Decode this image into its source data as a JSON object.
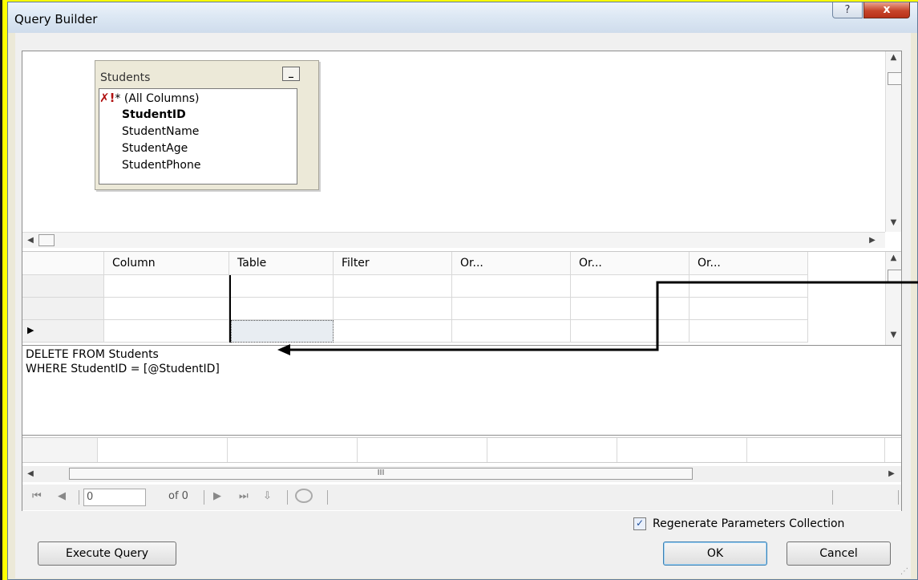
{
  "window": {
    "title": "Query Builder",
    "help_glyph": "?",
    "close_glyph": "x"
  },
  "diagram": {
    "table": {
      "name": "Students",
      "minimize_glyph": "_",
      "columns": [
        {
          "label": "* (All Columns)",
          "bold": false,
          "marker": "✗!"
        },
        {
          "label": "StudentID",
          "bold": true
        },
        {
          "label": "StudentName",
          "bold": false
        },
        {
          "label": "StudentAge",
          "bold": false
        },
        {
          "label": "StudentPhone",
          "bold": false
        }
      ]
    }
  },
  "grid": {
    "headers": [
      "Column",
      "Table",
      "Filter",
      "Or...",
      "Or...",
      "Or..."
    ],
    "current_row_glyph": "▶"
  },
  "sql": {
    "lines": [
      "DELETE FROM Students",
      "WHERE StudentID = [@StudentID]"
    ]
  },
  "results": {
    "scroll_label": "III",
    "navigator": {
      "first": "⏮",
      "prev": "◀",
      "position": "0",
      "of_label": "of 0",
      "next": "▶",
      "last": "⏭"
    }
  },
  "options": {
    "regenerate_label": "Regenerate Parameters Collection",
    "regenerate_checked": true
  },
  "buttons": {
    "execute": "Execute Query",
    "ok": "OK",
    "cancel": "Cancel"
  },
  "colors": {
    "background": "#ffff00",
    "accent": "#3c7fb1"
  }
}
